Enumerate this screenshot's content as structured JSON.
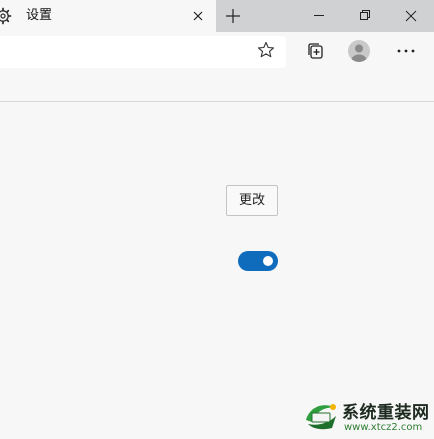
{
  "tab": {
    "title": "设置",
    "icon": "gear-icon"
  },
  "window_controls": {
    "minimize_icon": "minimize-icon",
    "restore_icon": "restore-icon",
    "close_icon": "close-icon"
  },
  "toolbar": {
    "favorite_icon": "star-icon",
    "collections_icon": "collections-icon",
    "profile_icon": "profile-icon",
    "more_icon": "more-icon"
  },
  "content": {
    "change_button_label": "更改",
    "toggle": {
      "state": "on",
      "color": "#0f6cbd"
    }
  },
  "watermark": {
    "title": "系统重装网",
    "url": "www.xtcz2.com"
  }
}
